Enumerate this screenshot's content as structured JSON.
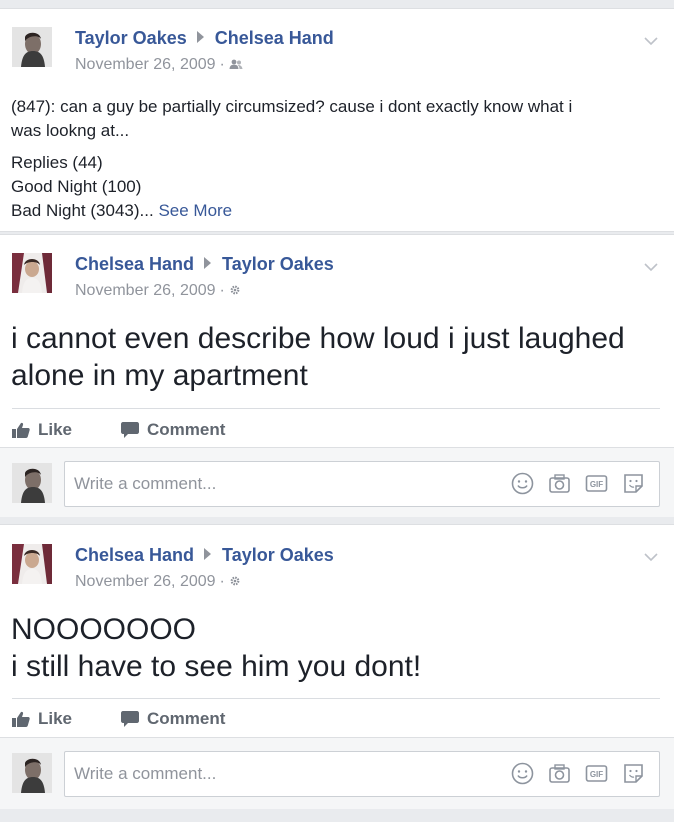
{
  "posts": [
    {
      "author": "Taylor Oakes",
      "target": "Chelsea Hand",
      "date": "November 26, 2009",
      "dot": "·",
      "audience_icon": "friends-icon",
      "body_lines": [
        "(847): can a guy be partially circumsized? cause i dont exactly know what i",
        "was lookng at...",
        "Replies (44)",
        "Good Night (100)"
      ],
      "last_line": "Bad Night (3043)...",
      "see_more": "See More"
    },
    {
      "author": "Chelsea Hand",
      "target": "Taylor Oakes",
      "date": "November 26, 2009",
      "dot": "·",
      "audience_icon": "gear-icon",
      "body_lines": [
        "i cannot even describe how loud i just laughed",
        "alone in my apartment"
      ],
      "like_label": "Like",
      "comment_label": "Comment",
      "comment_placeholder": "Write a comment..."
    },
    {
      "author": "Chelsea Hand",
      "target": "Taylor Oakes",
      "date": "November 26, 2009",
      "dot": "·",
      "audience_icon": "gear-icon",
      "body_lines": [
        "NOOOOOOO",
        "i still have to see him you dont!"
      ],
      "like_label": "Like",
      "comment_label": "Comment",
      "comment_placeholder": "Write a comment..."
    }
  ],
  "colors": {
    "link": "#385898",
    "meta": "#90949c",
    "text": "#1d2129",
    "background": "#e9ebee",
    "action": "#606770"
  },
  "comment_icons": [
    "emoji-icon",
    "camera-icon",
    "gif-icon",
    "sticker-icon"
  ]
}
